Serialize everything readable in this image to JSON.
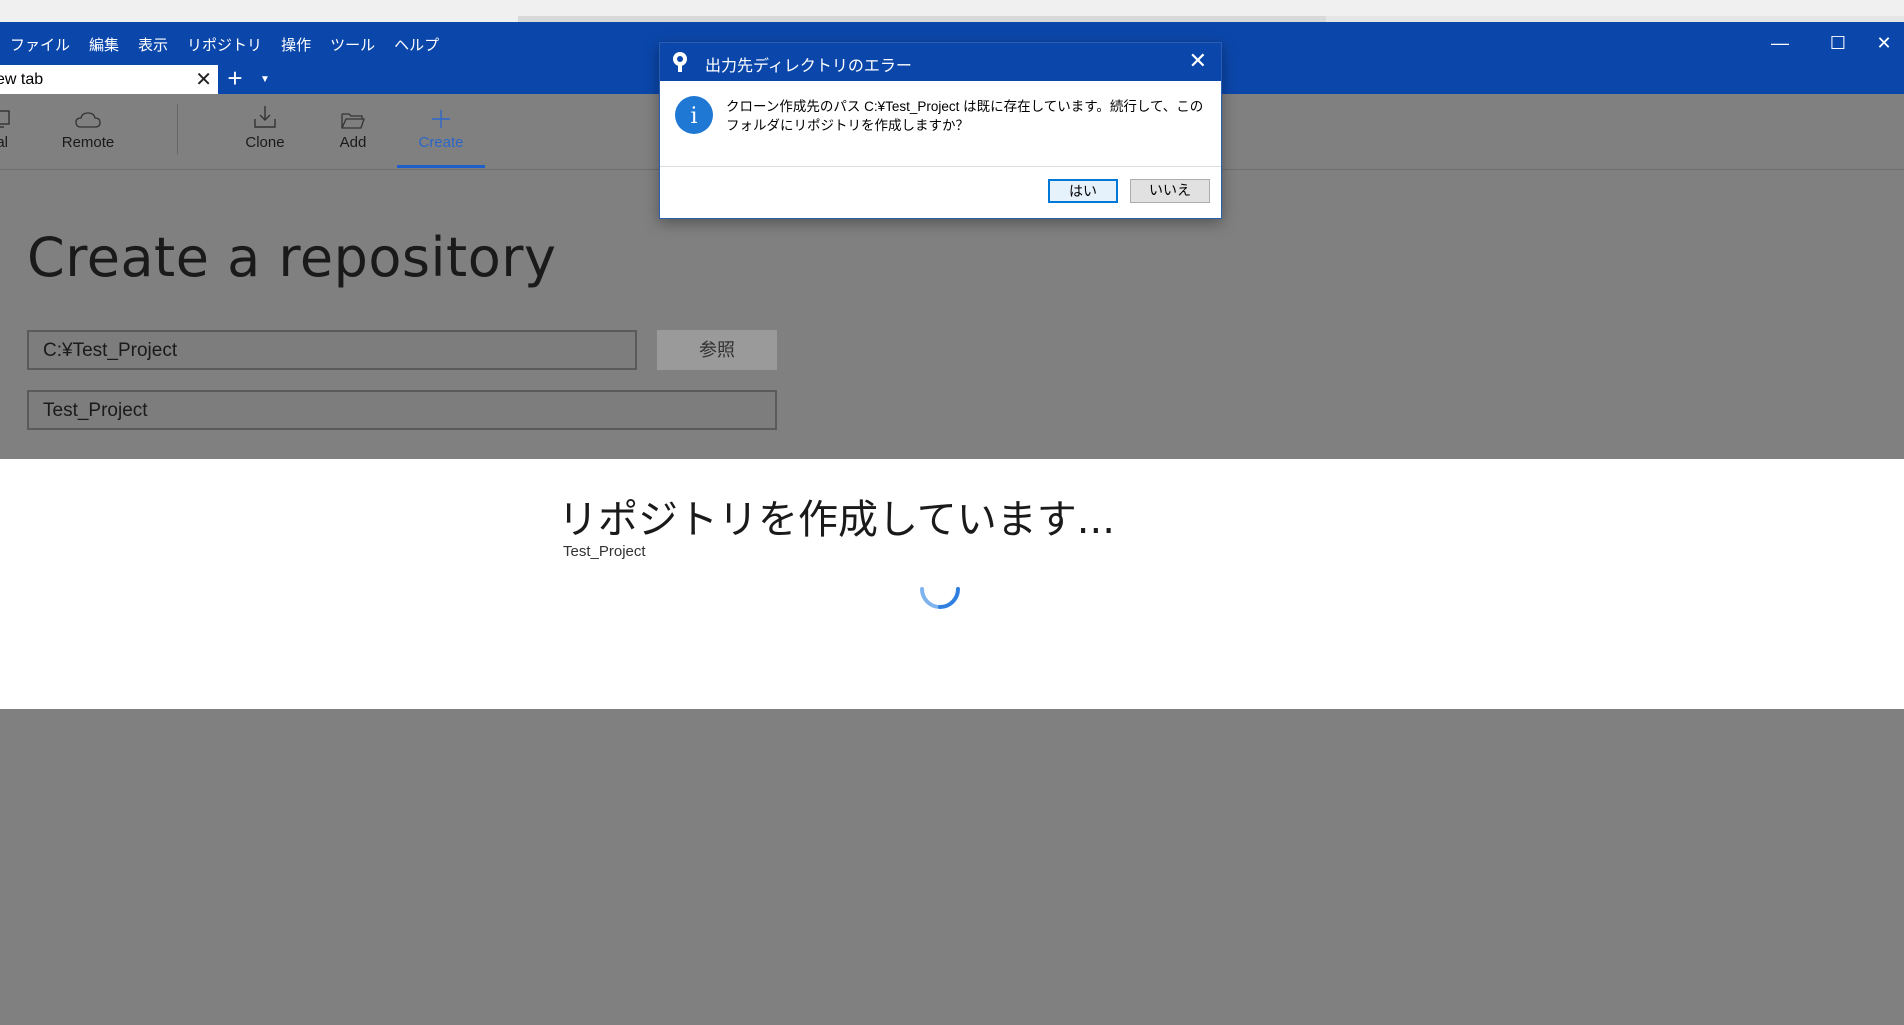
{
  "menu": {
    "items": [
      "ファイル",
      "編集",
      "表示",
      "リポジトリ",
      "操作",
      "ツール",
      "ヘルプ"
    ]
  },
  "tabs": {
    "active_label": "ew tab",
    "close_glyph": "✕",
    "add_glyph": "+",
    "dropdown_glyph": "▼"
  },
  "window_controls": {
    "minimize": "—",
    "maximize": "☐",
    "close": "✕"
  },
  "toolbar": {
    "local_label": "cal",
    "remote_label": "Remote",
    "clone_label": "Clone",
    "add_label": "Add",
    "create_label": "Create",
    "active": "Create"
  },
  "form": {
    "title": "Create a repository",
    "path_value": "C:¥Test_Project",
    "browse_label": "参照",
    "name_value": "Test_Project"
  },
  "loading": {
    "title": "リポジトリを作成しています...",
    "subtitle": "Test_Project"
  },
  "dialog": {
    "title": "出力先ディレクトリのエラー",
    "message": "クローン作成先のパス C:¥Test_Project は既に存在しています。続行して、このフォルダにリポジトリを作成しますか？",
    "info_glyph": "i",
    "yes_label": "はい",
    "no_label": "いいえ",
    "close_glyph": "✕"
  },
  "colors": {
    "titlebar": "#0b47ab",
    "accent": "#1f5fc9",
    "overlay": "#808080"
  }
}
